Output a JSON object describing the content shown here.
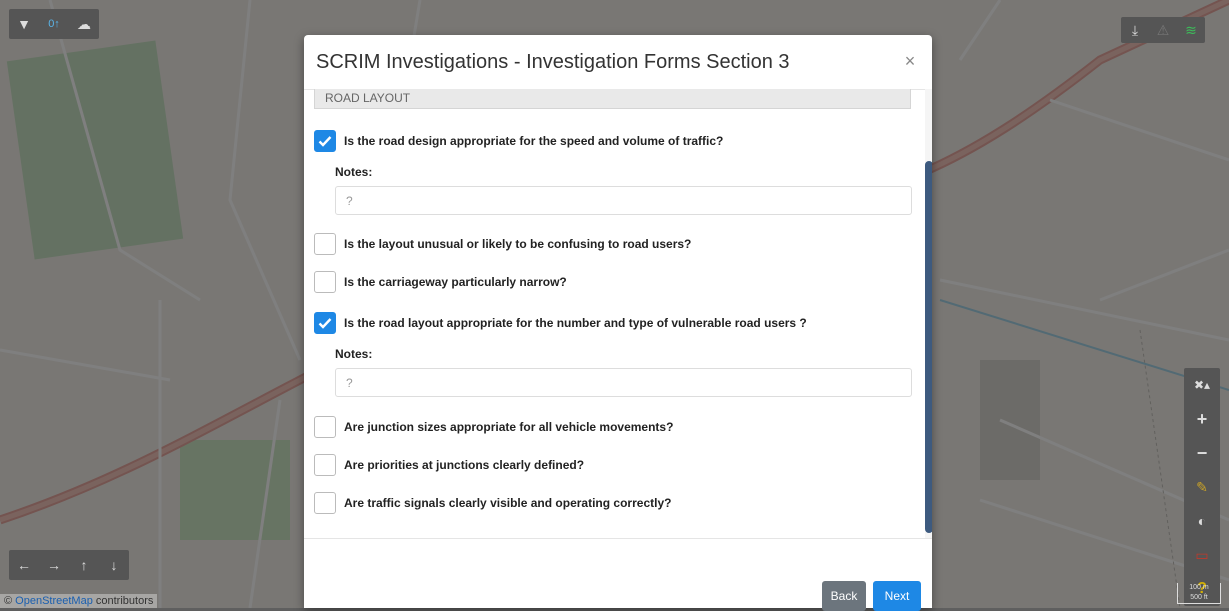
{
  "toolbar_left": [
    {
      "icon": "filter-icon",
      "glyph": "▼"
    },
    {
      "icon": "upload-count-icon",
      "glyph": "0↑"
    },
    {
      "icon": "cloud-upload-icon",
      "glyph": "☁"
    }
  ],
  "toolbar_right": [
    {
      "icon": "download-icon",
      "glyph": "⤓"
    },
    {
      "icon": "warning-icon",
      "glyph": "⚠"
    },
    {
      "icon": "wifi-icon",
      "glyph": "≋"
    }
  ],
  "nav_arrows": [
    {
      "icon": "arrow-left-icon",
      "glyph": "←"
    },
    {
      "icon": "arrow-right-icon",
      "glyph": "→"
    },
    {
      "icon": "arrow-up-icon",
      "glyph": "↑"
    },
    {
      "icon": "arrow-down-icon",
      "glyph": "↓"
    }
  ],
  "map_tools": [
    {
      "icon": "tools-icon",
      "glyph": "✖▴",
      "color": "#cccccc"
    },
    {
      "icon": "zoom-in-icon",
      "glyph": "+",
      "color": "#cccccc"
    },
    {
      "icon": "zoom-out-icon",
      "glyph": "−",
      "color": "#cccccc"
    },
    {
      "icon": "pencil-icon",
      "glyph": "✎",
      "color": "#c9a227"
    },
    {
      "icon": "contrast-icon",
      "glyph": "◐",
      "color": "#dddddd"
    },
    {
      "icon": "bookmark-icon",
      "glyph": "▭",
      "color": "#c0392b"
    },
    {
      "icon": "help-icon",
      "glyph": "?",
      "color": "#d4b106"
    }
  ],
  "attribution": {
    "symbol": "©",
    "link": "OpenStreetMap",
    "rest": " contributors"
  },
  "scale": {
    "top": "100 m",
    "bottom": "500 ft"
  },
  "modal": {
    "title": "SCRIM Investigations - Investigation Forms Section 3",
    "close": "×",
    "section": "ROAD LAYOUT",
    "notes_label": "Notes:",
    "notes_placeholder": "?",
    "questions": [
      {
        "label": "Is the road design appropriate for the speed and volume of traffic?",
        "checked": true
      },
      {
        "label": "Is the layout unusual or likely to be confusing to road users?",
        "checked": false
      },
      {
        "label": "Is the carriageway particularly narrow?",
        "checked": false
      },
      {
        "label": "Is the road layout appropriate for the number and type of vulnerable road users ?",
        "checked": true
      },
      {
        "label": "Are junction sizes appropriate for all vehicle movements?",
        "checked": false
      },
      {
        "label": "Are priorities at junctions clearly defined?",
        "checked": false
      },
      {
        "label": "Are traffic signals clearly visible and operating correctly?",
        "checked": false
      }
    ],
    "back_label": "Back",
    "next_label": "Next"
  },
  "colors": {
    "accent": "#1e88e5",
    "scroll": "#3d5a7f",
    "back": "#6c757d"
  }
}
